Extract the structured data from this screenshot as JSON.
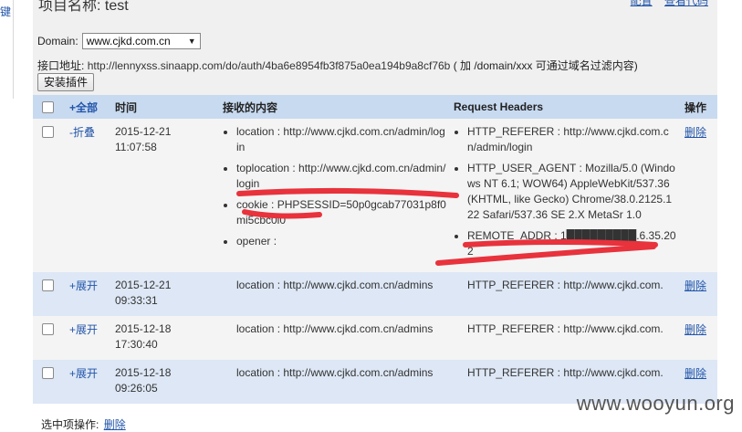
{
  "sidebar": {
    "fragment": "键"
  },
  "header": {
    "title": "项目名称: test",
    "links": [
      "配置",
      "查看代码"
    ]
  },
  "domain": {
    "label": "Domain:",
    "selected": "www.cjkd.com.cn"
  },
  "api": {
    "label": "接口地址:",
    "url": "http://lennyxss.sinaapp.com/do/auth/4ba6e8954fb3f875a0ea194b9a8cf76b",
    "hint": "( 加 /domain/xxx 可通过域名过滤内容)"
  },
  "install_button": "安装插件",
  "table": {
    "headers": {
      "toggle_all": "+全部",
      "time": "时间",
      "content": "接收的内容",
      "headers": "Request Headers",
      "action": "操作"
    },
    "rows": [
      {
        "toggle": "-折叠",
        "date": "2015-12-21",
        "time": "11:07:58",
        "content": [
          "location : http://www.cjkd.com.cn/admin/login",
          "toplocation : http://www.cjkd.com.cn/admin/login",
          "cookie : PHPSESSID=50p0gcab77031p8f0mi5cbc0i0",
          "opener :"
        ],
        "headers": [
          "HTTP_REFERER : http://www.cjkd.com.cn/admin/login",
          "HTTP_USER_AGENT : Mozilla/5.0 (Windows NT 6.1; WOW64) AppleWebKit/537.36 (KHTML, like Gecko) Chrome/38.0.2125.122 Safari/537.36 SE 2.X MetaSr 1.0",
          "REMOTE_ADDR : 1█████████.6.35.202"
        ],
        "action": "删除"
      },
      {
        "toggle": "+展开",
        "date": "2015-12-21",
        "time": "09:33:31",
        "content": [
          "location : http://www.cjkd.com.cn/admins"
        ],
        "headers": [
          "HTTP_REFERER : http://www.cjkd.com."
        ],
        "action": "删除"
      },
      {
        "toggle": "+展开",
        "date": "2015-12-18",
        "time": "17:30:40",
        "content": [
          "location : http://www.cjkd.com.cn/admins"
        ],
        "headers": [
          "HTTP_REFERER : http://www.cjkd.com."
        ],
        "action": "删除"
      },
      {
        "toggle": "+展开",
        "date": "2015-12-18",
        "time": "09:26:05",
        "content": [
          "location : http://www.cjkd.com.cn/admins"
        ],
        "headers": [
          "HTTP_REFERER : http://www.cjkd.com."
        ],
        "action": "删除"
      }
    ]
  },
  "bottom": {
    "label": "选中项操作:",
    "delete": "删除"
  },
  "watermark": "www.wooyun.org",
  "colors": {
    "header_bg": "#c8daf0",
    "row_alt_bg": "#dde7f5",
    "link": "#2255aa",
    "redaction": "#e8323c"
  }
}
